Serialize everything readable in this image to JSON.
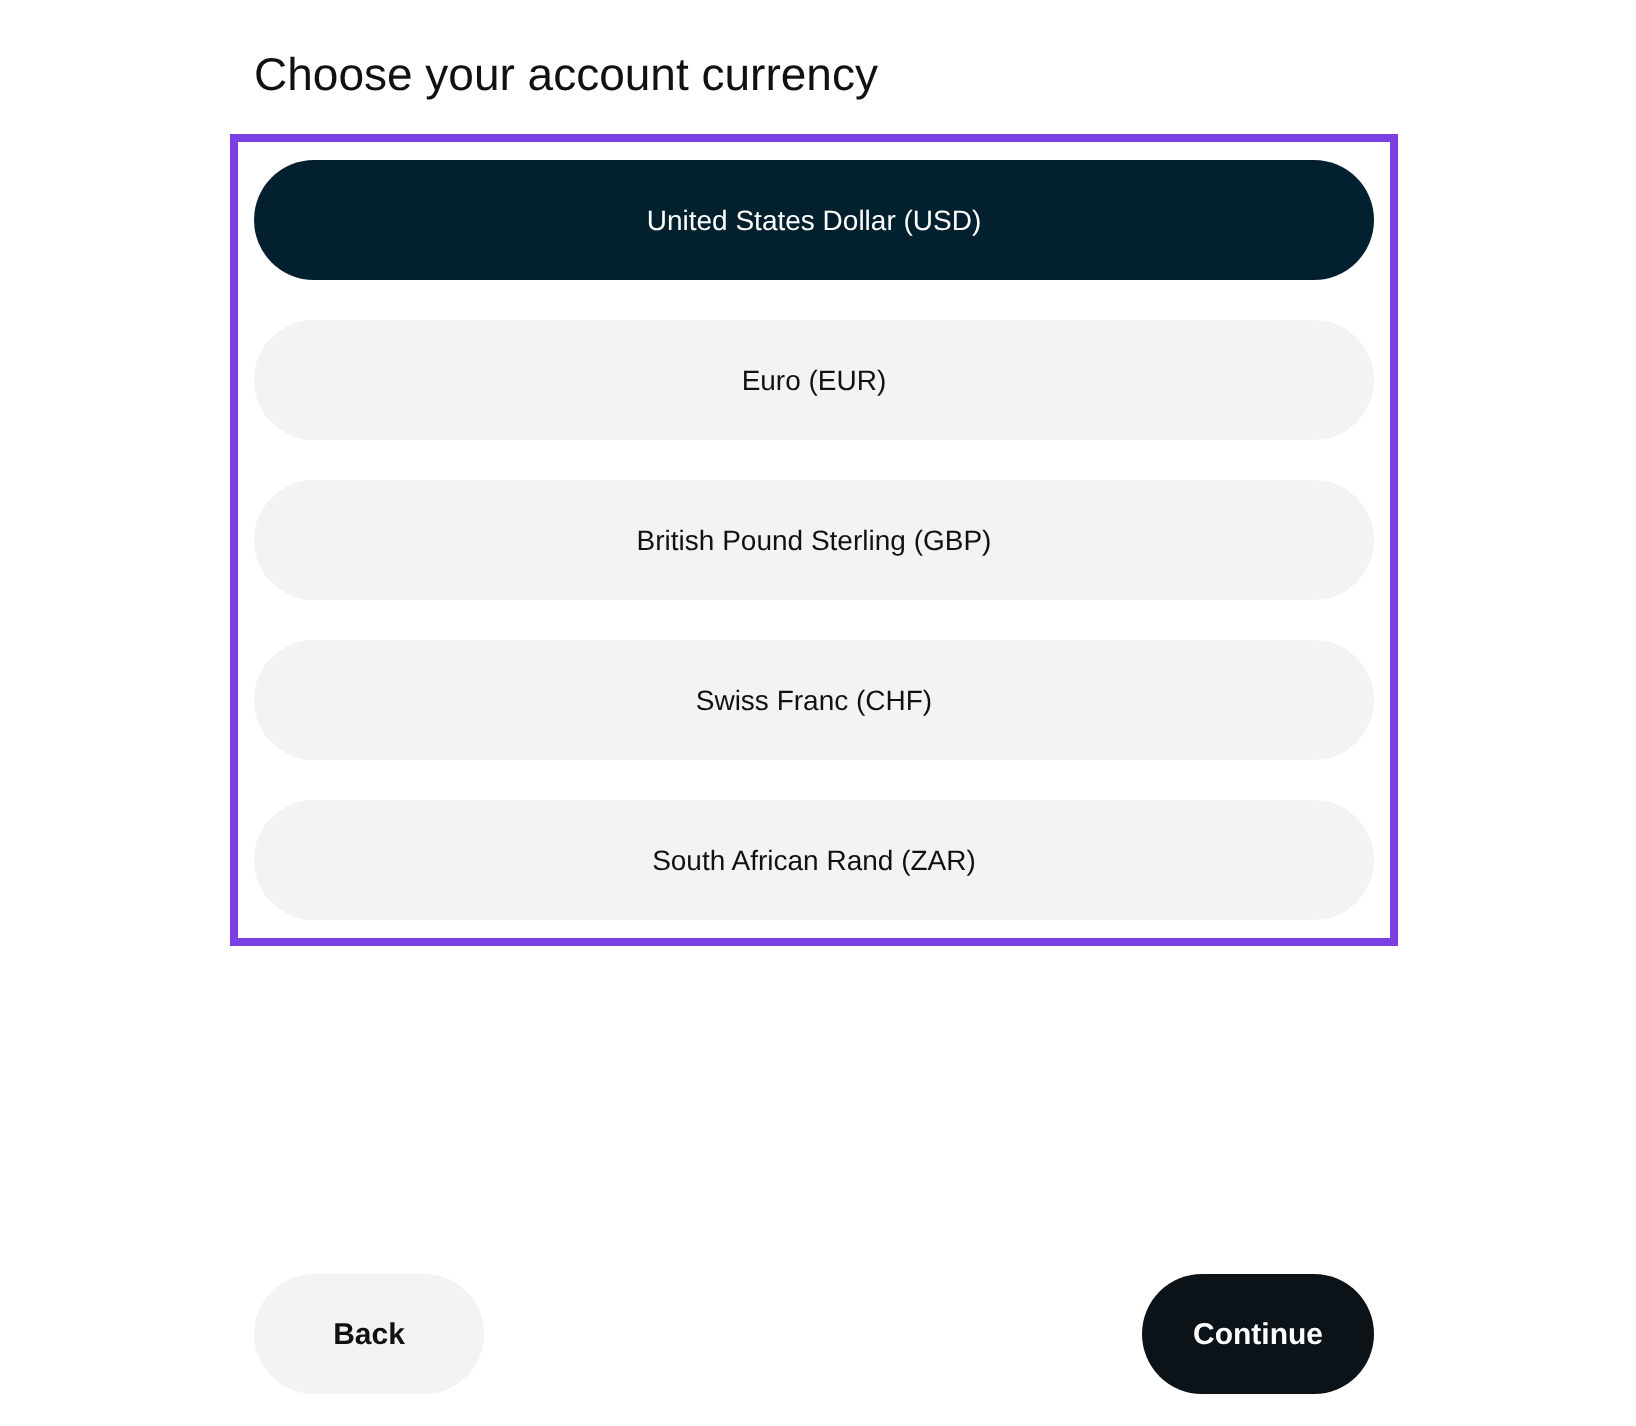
{
  "title": "Choose your account currency",
  "currencies": [
    {
      "label": "United States Dollar (USD)",
      "selected": true
    },
    {
      "label": "Euro (EUR)",
      "selected": false
    },
    {
      "label": "British Pound Sterling (GBP)",
      "selected": false
    },
    {
      "label": "Swiss Franc (CHF)",
      "selected": false
    },
    {
      "label": "South African Rand (ZAR)",
      "selected": false
    }
  ],
  "highlighted": true,
  "buttons": [
    {
      "kind": "secondary",
      "label": "Back"
    },
    {
      "kind": "primary",
      "label": "Continue"
    }
  ]
}
